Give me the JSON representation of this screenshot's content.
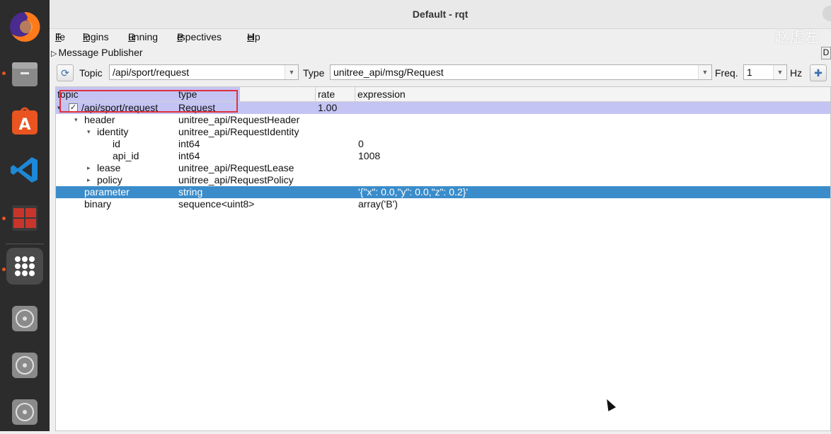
{
  "window": {
    "title": "Default - rqt",
    "watermark": "赵虚左"
  },
  "menu": [
    "File",
    "Plugins",
    "Running",
    "Perspectives",
    "Help"
  ],
  "menu_mnemonics": [
    "F",
    "P",
    "R",
    "e",
    "H"
  ],
  "plugin": {
    "name": "Message Publisher",
    "dock_tag": "D"
  },
  "toolbar": {
    "topic_label": "Topic",
    "topic_value": "/api/sport/request",
    "type_label": "Type",
    "type_value": "unitree_api/msg/Request",
    "freq_label": "Freq.",
    "freq_value": "1",
    "hz_label": "Hz"
  },
  "table": {
    "columns": [
      "topic",
      "type",
      "rate",
      "expression"
    ],
    "rows": [
      {
        "level": 0,
        "name": "/api/sport/request",
        "type": "Request",
        "rate": "1.00",
        "expression": "",
        "expander": "down",
        "checked": true,
        "checkmark": "✓"
      },
      {
        "level": 1,
        "name": "header",
        "type": "unitree_api/RequestHeader",
        "rate": "",
        "expression": "",
        "expander": "down"
      },
      {
        "level": 2,
        "name": "identity",
        "type": "unitree_api/RequestIdentity",
        "rate": "",
        "expression": "",
        "expander": "down"
      },
      {
        "level": 3,
        "name": "id",
        "type": "int64",
        "rate": "",
        "expression": "0",
        "expander": "none"
      },
      {
        "level": 3,
        "name": "api_id",
        "type": "int64",
        "rate": "",
        "expression": "1008",
        "expander": "none"
      },
      {
        "level": 2,
        "name": "lease",
        "type": "unitree_api/RequestLease",
        "rate": "",
        "expression": "",
        "expander": "right"
      },
      {
        "level": 2,
        "name": "policy",
        "type": "unitree_api/RequestPolicy",
        "rate": "",
        "expression": "",
        "expander": "right"
      },
      {
        "level": 1,
        "name": "parameter",
        "type": "string",
        "rate": "",
        "expression": "'{\"x\": 0.0,\"y\": 0.0,\"z\": 0.2}'",
        "expander": "none",
        "selected": true
      },
      {
        "level": 1,
        "name": "binary",
        "type": "sequence<uint8>",
        "rate": "",
        "expression": "array('B')",
        "expander": "none"
      }
    ]
  },
  "dock": [
    {
      "icon": "firefox-icon",
      "color": "#e66000"
    },
    {
      "icon": "files-icon",
      "color": "#8a8a8a"
    },
    {
      "icon": "app-center-icon",
      "color": "#e95420"
    },
    {
      "icon": "vscode-icon",
      "color": "#1e88d6"
    },
    {
      "icon": "terminal-icon",
      "color": "#b5342a"
    },
    {
      "icon": "show-apps-icon",
      "color": "#ffffff"
    },
    {
      "icon": "disc-icon",
      "color": "#9a9a9a"
    },
    {
      "icon": "disc-icon",
      "color": "#9a9a9a"
    },
    {
      "icon": "disc-icon",
      "color": "#9a9a9a"
    }
  ]
}
